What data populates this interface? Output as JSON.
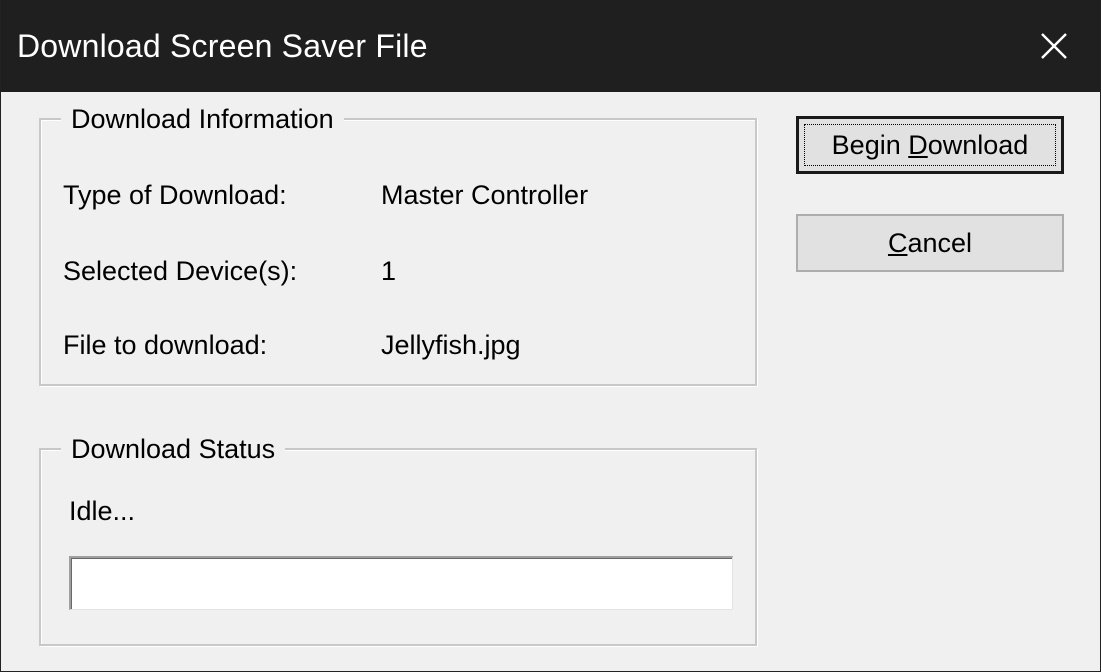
{
  "window": {
    "title": "Download Screen Saver File"
  },
  "download_information": {
    "legend": "Download Information",
    "rows": [
      {
        "label": "Type of Download:",
        "value": "Master Controller"
      },
      {
        "label": "Selected Device(s):",
        "value": "1"
      },
      {
        "label": "File to download:",
        "value": "Jellyfish.jpg"
      }
    ]
  },
  "download_status": {
    "legend": "Download Status",
    "status_text": "Idle...",
    "progress_percent": 0
  },
  "buttons": {
    "begin_download": {
      "label_pre": "Begin ",
      "label_accel": "D",
      "label_post": "ownload"
    },
    "cancel": {
      "label_pre": "",
      "label_accel": "C",
      "label_post": "ancel"
    }
  },
  "icons": {
    "close": "close-icon"
  },
  "colors": {
    "titlebar_bg": "#1f1f1f",
    "dialog_bg": "#f0f0f0"
  }
}
